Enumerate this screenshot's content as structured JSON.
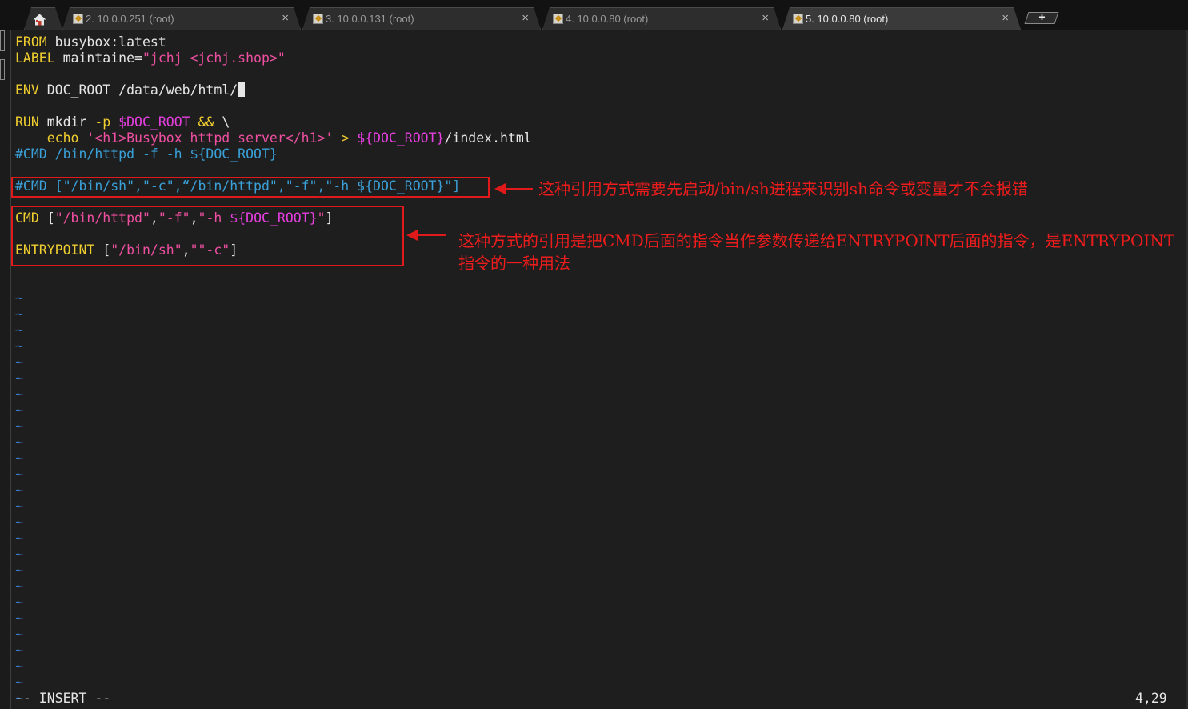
{
  "tabs": [
    {
      "label": "2. 10.0.0.251 (root)",
      "close": "×"
    },
    {
      "label": "3. 10.0.0.131 (root)",
      "close": "×"
    },
    {
      "label": "4.  10.0.0.80 (root)",
      "close": "×"
    },
    {
      "label": "5. 10.0.0.80 (root)",
      "close": "×",
      "active": true
    }
  ],
  "new_tab_label": "+",
  "code": {
    "l1": {
      "kw": "FROM",
      "rest": " busybox:latest"
    },
    "l2": {
      "kw": "LABEL",
      "rest": " maintaine=",
      "str": "\"jchj <jchj.shop>\""
    },
    "l4": {
      "kw": "ENV",
      "rest": " DOC_ROOT /data/web/html/"
    },
    "l6": {
      "kw": "RUN",
      "cmd": " mkdir ",
      "flag": "-p",
      "sp": " ",
      "var": "$DOC_ROOT",
      "sp2": " ",
      "op": "&&",
      "rest": " \\"
    },
    "l7": {
      "indent": "    ",
      "cmd": "echo ",
      "str": "'<h1>Busybox httpd server</h1>'",
      "sp": " ",
      "op": ">",
      "sp2": " ",
      "var": "${DOC_ROOT}",
      "rest": "/index.html"
    },
    "l8": {
      "comment": "#CMD /bin/httpd -f -h ${DOC_ROOT}"
    },
    "l10": {
      "comment": "#CMD [\"/bin/sh\",\"-c\",“/bin/httpd\",\"-f\",\"-h ${DOC_ROOT}\"]"
    },
    "l12": {
      "kw": "CMD",
      "p1": " [",
      "s1": "\"/bin/httpd\"",
      "c1": ",",
      "s2": "\"-f\"",
      "c2": ",",
      "s3": "\"-h ",
      "var": "${DOC_ROOT}",
      "s4": "\"",
      "p2": "]"
    },
    "l14": {
      "kw": "ENTRYPOINT",
      "p1": " [",
      "s1": "\"/bin/sh\"",
      "c1": ",",
      "s2": "\"\"-c\"",
      "p2": "]"
    }
  },
  "tilde": "~",
  "status": {
    "mode": "-- INSERT --",
    "position": "4,29"
  },
  "annotations": {
    "note1": "这种引用方式需要先启动/bin/sh进程来识别sh命令或变量才不会报错",
    "note2_line1": "这种方式的引用是把CMD后面的指令当作参数传递给ENTRYPOINT后面的指令，是ENTRYPOINT",
    "note2_line2": "指令的一种用法"
  },
  "colors": {
    "keyword": "#f0ce30",
    "string": "#ee4fa0",
    "variable": "#e63fe0",
    "comment": "#3aa0d8",
    "annotation": "#ee1c1c",
    "background": "#1e1e1e"
  }
}
